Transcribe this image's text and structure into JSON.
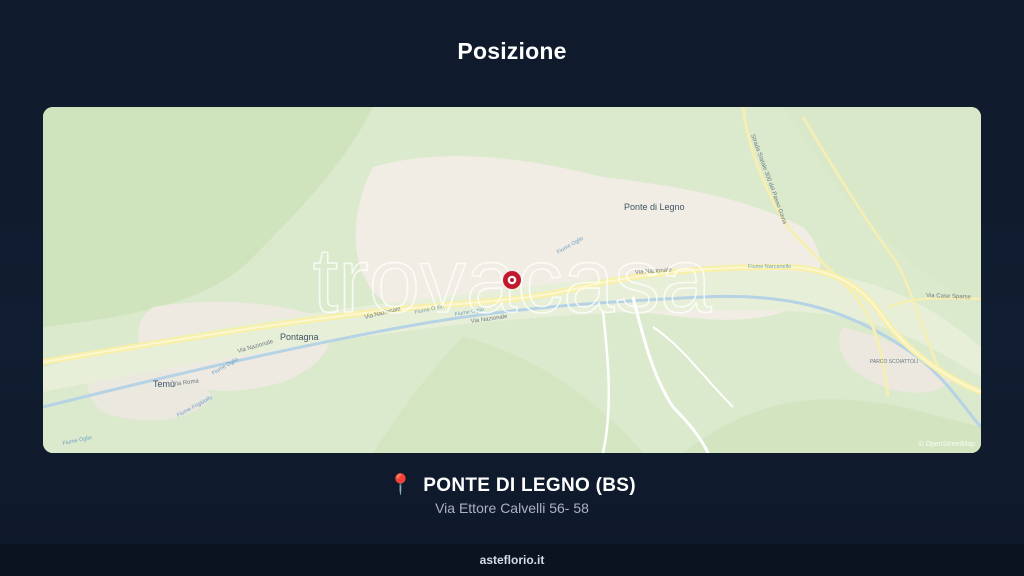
{
  "header": {
    "title": "Posizione"
  },
  "map": {
    "watermark": "trovacasa",
    "attribution": "© OpenStreetMap",
    "labels": {
      "ponte_di_legno": "Ponte di Legno",
      "pontagna": "Pontagna",
      "temu": "Temù",
      "via_roma": "Via Roma",
      "via_nazionale_1": "Via Nazionale",
      "via_nazionale_2": "Via Nazionale",
      "via_nazionale_3": "Via Nazionale",
      "via_nazionale_4": "Via Nazionale",
      "fiume_oglio_1": "Fiume Oglio",
      "fiume_oglio_2": "Fiume Oglio",
      "fiume_oglio_3": "Fiume Oglio",
      "fiume_oglio_4": "Fiume Oglio",
      "fiume_oglio_5": "Fiume Oglio",
      "frigidolfo": "Fiume Frigidolfo",
      "via_case_sparse": "Via Case Sparse",
      "strada_passo_gavia": "Strada Statale 300 del Passo Gavia",
      "narcanello": "Fiume Narcanello",
      "sp": "SP",
      "zoo": "PARCO SCOIATTOLI"
    },
    "marker_icon": "location-marker-icon",
    "accent_color": "#c0192e"
  },
  "location": {
    "pin_icon": "pushpin-icon",
    "name": "PONTE DI LEGNO (BS)",
    "address": "Via Ettore Calvelli 56- 58"
  },
  "footer": {
    "brand": "asteflorio.it"
  }
}
